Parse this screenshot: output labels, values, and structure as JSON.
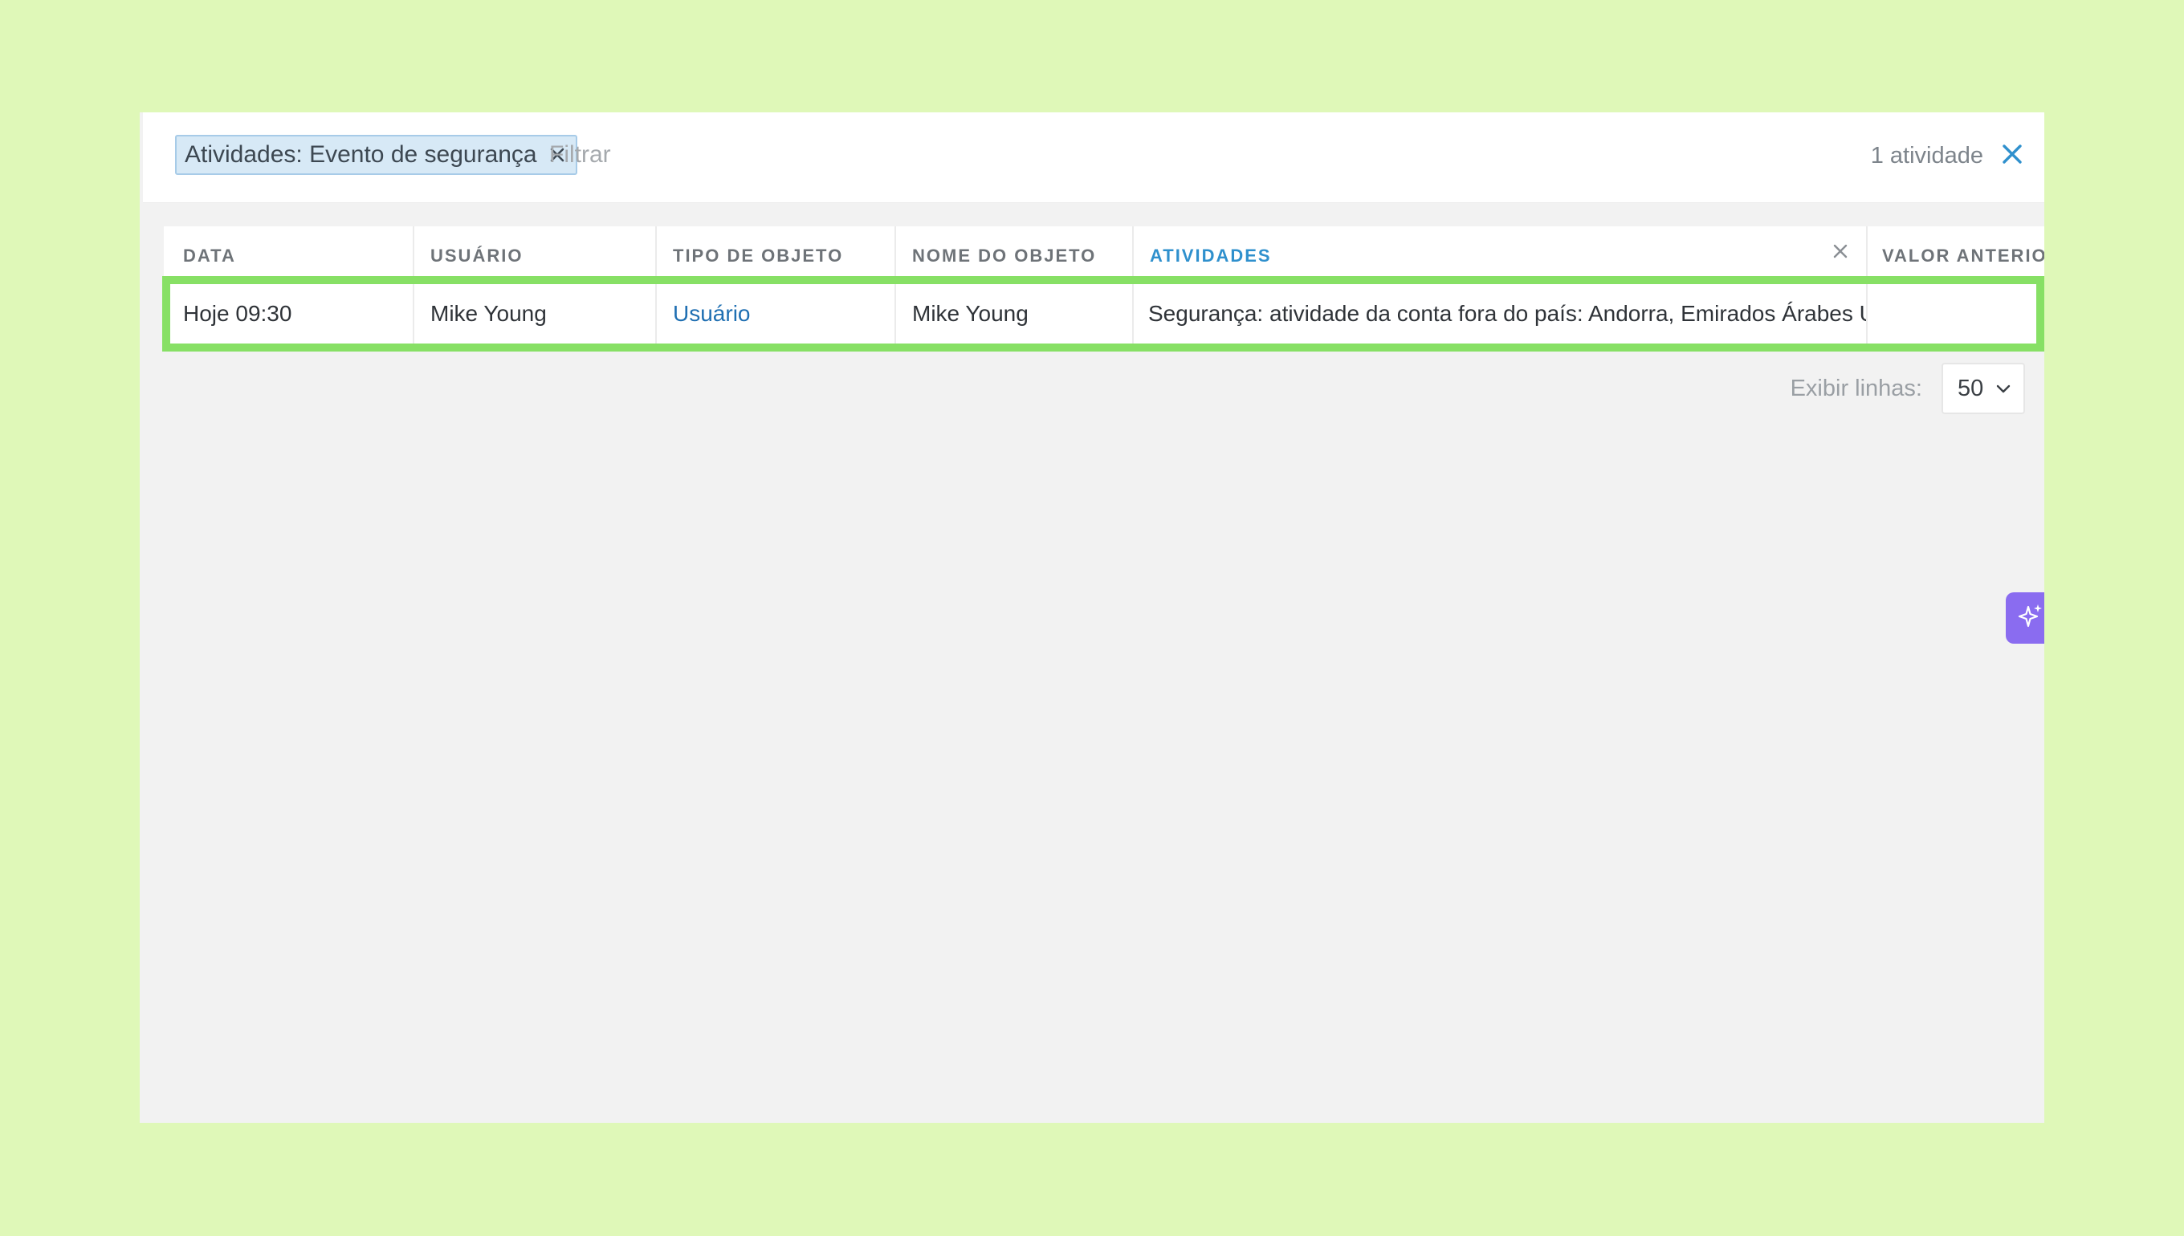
{
  "filter": {
    "chip_label": "Atividades: Evento de segurança",
    "placeholder": "Filtrar",
    "count_text": "1 atividade"
  },
  "table": {
    "columns": [
      {
        "key": "data",
        "label": "DATA"
      },
      {
        "key": "usuario",
        "label": "USUÁRIO"
      },
      {
        "key": "tipo_de_objeto",
        "label": "TIPO DE OBJETO"
      },
      {
        "key": "nome_do_objeto",
        "label": "NOME DO OBJETO"
      },
      {
        "key": "atividades",
        "label": "ATIVIDADES"
      },
      {
        "key": "valor_anterior",
        "label": "VALOR ANTERIO"
      }
    ],
    "rows": [
      {
        "data": "Hoje 09:30",
        "usuario": "Mike Young",
        "tipo_de_objeto": "Usuário",
        "nome_do_objeto": "Mike Young",
        "atividades": "Segurança: atividade da conta fora do país: Andorra, Emirados Árabes Unidos",
        "valor_anterior": ""
      }
    ]
  },
  "pagination": {
    "rows_label": "Exibir linhas:",
    "rows_value": "50"
  },
  "icons": {
    "chip_close": "close-icon",
    "close_all": "close-icon",
    "column_close": "close-icon",
    "rows_dropdown": "chevron-down-icon",
    "ai_assistant": "sparkle-icon"
  },
  "colors": {
    "page_background": "#dff8b8",
    "panel_background": "#f2f2f2",
    "accent_blue": "#2f90cd",
    "link_blue": "#1f6fb2",
    "highlight_green": "#87e065",
    "chip_background": "#d7e9f6",
    "ai_button": "#8a6cf0"
  }
}
